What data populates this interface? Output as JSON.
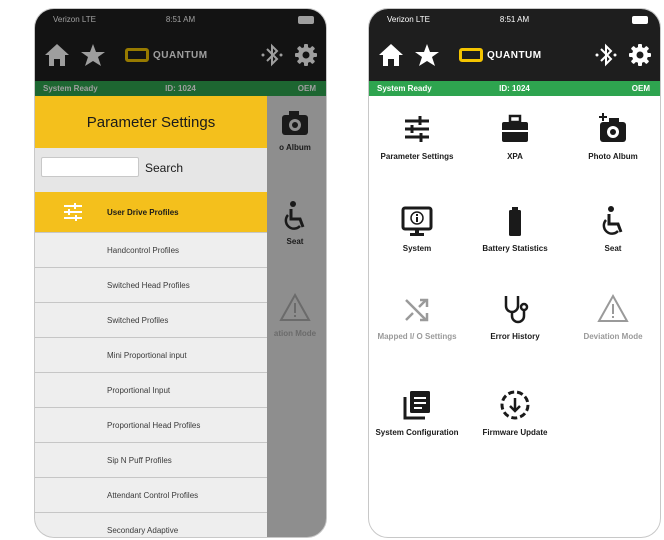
{
  "status_bar": {
    "carrier": "Verizon LTE",
    "time": "8:51 AM"
  },
  "app_bar": {
    "logo_text": "QUANTUM",
    "icons": [
      "home-icon",
      "star-icon",
      "bluetooth-icon",
      "gear-icon"
    ]
  },
  "system_status": {
    "state": "System Ready",
    "id": "ID: 1024",
    "mode": "OEM"
  },
  "drawer": {
    "title": "Parameter Settings",
    "search_label": "Search",
    "items": [
      {
        "label": "User Drive Profiles",
        "active": true
      },
      {
        "label": "Handcontrol Profiles"
      },
      {
        "label": "Switched Head Profiles"
      },
      {
        "label": "Switched Profiles"
      },
      {
        "label": "Mini Proportional input"
      },
      {
        "label": "Proportional Input"
      },
      {
        "label": "Proportional Head Profiles"
      },
      {
        "label": "Sip N Puff Profiles"
      },
      {
        "label": "Attendant Control Profiles"
      },
      {
        "label": "Secondary Adaptive"
      }
    ]
  },
  "behind_tiles": {
    "photo_album": "o Album",
    "seat": "Seat",
    "deviation_mode": "ation Mode"
  },
  "grid": {
    "parameter_settings": "Parameter Settings",
    "xpa": "XPA",
    "photo_album": "Photo Album",
    "system": "System",
    "battery_statistics": "Battery Statistics",
    "seat": "Seat",
    "mapped_io": "Mapped I/ O Settings",
    "error_history": "Error History",
    "deviation_mode": "Deviation Mode",
    "system_configuration": "System Configuration",
    "firmware_update": "Firmware Update"
  },
  "colors": {
    "accent_yellow": "#f4c01c",
    "status_green": "#2ea44f",
    "app_bar": "#1e1e1e",
    "disabled_gray": "#9a9a9a"
  }
}
